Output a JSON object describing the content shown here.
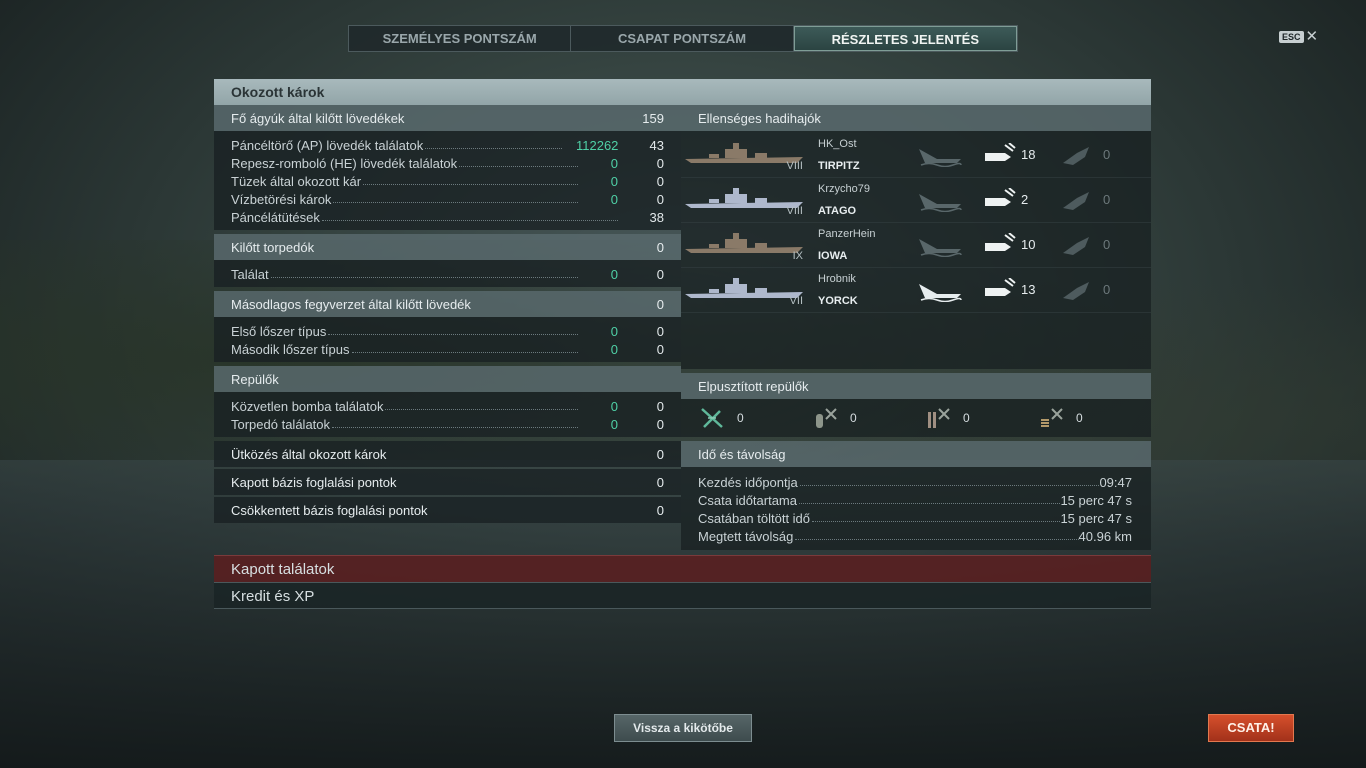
{
  "tabs": [
    "SZEMÉLYES PONTSZÁM",
    "CSAPAT PONTSZÁM",
    "RÉSZLETES JELENTÉS"
  ],
  "esc": "ESC",
  "close": "✕",
  "panel_title": "Okozott károk",
  "main_guns": {
    "header": "Fő ágyúk által kilőtt lövedékek",
    "header_value": "159",
    "rows": [
      {
        "label": "Páncéltörő (AP) lövedék találatok",
        "damage": "112262",
        "count": "43"
      },
      {
        "label": "Repesz-romboló (HE) lövedék találatok",
        "damage": "0",
        "count": "0"
      },
      {
        "label": "Tüzek által okozott kár",
        "damage": "0",
        "count": "0"
      },
      {
        "label": "Vízbetörési károk",
        "damage": "0",
        "count": "0"
      },
      {
        "label": "Páncélátütések",
        "count": "38"
      }
    ]
  },
  "torpedoes": {
    "header": "Kilőtt torpedók",
    "header_value": "0",
    "rows": [
      {
        "label": "Találat",
        "damage": "0",
        "count": "0"
      }
    ]
  },
  "secondary": {
    "header": "Másodlagos fegyverzet által kilőtt lövedék",
    "header_value": "0",
    "rows": [
      {
        "label": "Első lőszer típus",
        "damage": "0",
        "count": "0"
      },
      {
        "label": "Második lőszer típus",
        "damage": "0",
        "count": "0"
      }
    ]
  },
  "aircraft": {
    "header": "Repülők",
    "rows": [
      {
        "label": "Közvetlen bomba találatok",
        "damage": "0",
        "count": "0"
      },
      {
        "label": "Torpedó találatok",
        "damage": "0",
        "count": "0"
      }
    ]
  },
  "singles": [
    {
      "label": "Ütközés által okozott károk",
      "value": "0"
    },
    {
      "label": "Kapott bázis foglalási pontok",
      "value": "0"
    },
    {
      "label": "Csökkentett bázis foglalási pontok",
      "value": "0"
    }
  ],
  "enemy_ships": {
    "header": "Ellenséges hadihajók",
    "ships": [
      {
        "player": "HK_Ost",
        "name": "TIRPITZ",
        "tier": "VIII",
        "hits": "18",
        "fires": "0",
        "hull": "#8a7a68",
        "sunk": false
      },
      {
        "player": "Krzycho79",
        "name": "ATAGO",
        "tier": "VIII",
        "hits": "2",
        "fires": "0",
        "hull": "#aeb8cc",
        "sunk": false
      },
      {
        "player": "PanzerHein",
        "name": "IOWA",
        "tier": "IX",
        "hits": "10",
        "fires": "0",
        "hull": "#8a7a68",
        "sunk": false
      },
      {
        "player": "Hrobnik",
        "name": "YORCK",
        "tier": "VII",
        "hits": "13",
        "fires": "0",
        "hull": "#aeb8cc",
        "sunk": true
      }
    ]
  },
  "destroyed_planes": {
    "header": "Elpusztított repülők",
    "items": [
      {
        "icon": "fighter-plane-icon",
        "value": "0"
      },
      {
        "icon": "bomber-plane-icon",
        "value": "0"
      },
      {
        "icon": "torpedo-bomber-icon",
        "value": "0"
      },
      {
        "icon": "scout-plane-icon",
        "value": "0"
      }
    ]
  },
  "time": {
    "header": "Idő és távolság",
    "rows": [
      {
        "label": "Kezdés időpontja",
        "value": "09:47"
      },
      {
        "label": "Csata időtartama",
        "value": "15 perc 47 s"
      },
      {
        "label": "Csatában töltött idő",
        "value": "15 perc 47 s"
      },
      {
        "label": "Megtett távolság",
        "value": "40.96 km"
      }
    ]
  },
  "received_hits": "Kapott találatok",
  "credits_xp": "Kredit és XP",
  "back_to_port": "Vissza a kikötőbe",
  "battle": "CSATA!"
}
